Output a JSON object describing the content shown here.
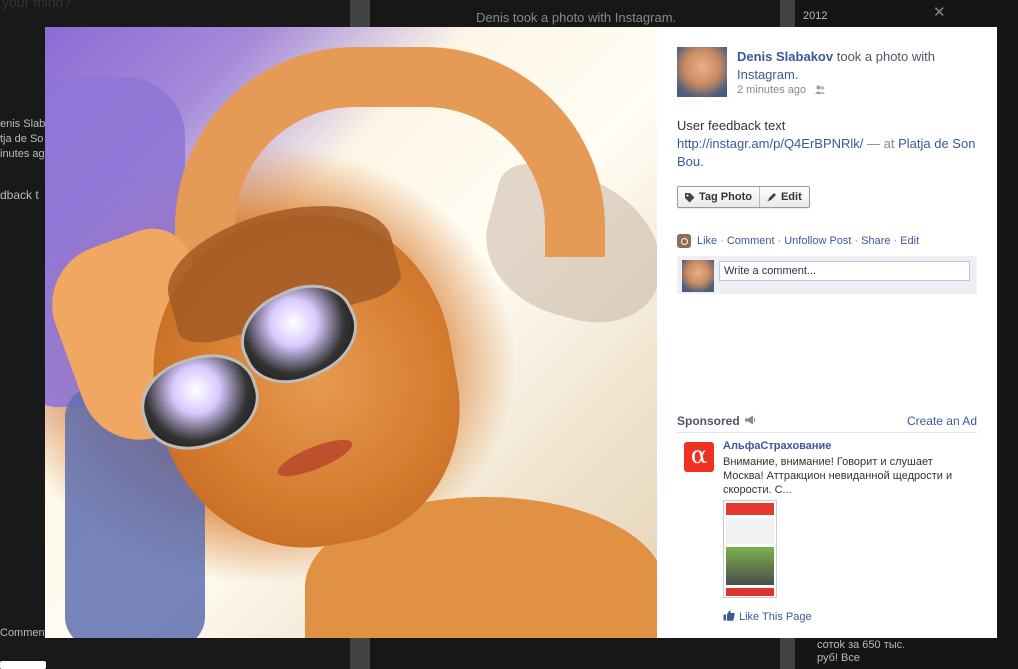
{
  "background": {
    "top_text": "your mind?",
    "story_text": "Denis took a photo with Instagram.",
    "year_label": "2012",
    "left_fragments": [
      "enis Slab",
      "tja de So",
      "inutes ag",
      "dback t",
      "Comment"
    ],
    "right_fragments": [
      "сотоk за 650 тыс.",
      "руб! Все"
    ]
  },
  "post": {
    "author": "Denis Slabakov",
    "action_text": " took a photo with ",
    "app_name": "Instagram.",
    "timestamp": "2 minutes ago",
    "caption_text": "User feedback text",
    "caption_link": "http://instagr.am/p/Q4ErBPNRlk/",
    "at_separator": " — at ",
    "location": "Platja de Son Bou."
  },
  "buttons": {
    "tag_photo": "Tag Photo",
    "edit": "Edit"
  },
  "actions": {
    "like": "Like",
    "comment": "Comment",
    "unfollow": "Unfollow Post",
    "share": "Share",
    "edit": "Edit",
    "separator": "·"
  },
  "comment": {
    "placeholder": "Write a comment..."
  },
  "sponsored": {
    "label": "Sponsored",
    "create_ad": "Create an Ad",
    "ad_title": "АльфаСтрахование",
    "ad_body": "Внимание, внимание! Говорит и слушает Москва! Аттракцион невиданной щедрости и скорости. С...",
    "ad_logo_glyph": "α",
    "like_page": "Like This Page"
  },
  "colors": {
    "link": "#3b5998",
    "ad_brand": "#ef3124"
  },
  "icons": [
    "close-icon",
    "people-icon",
    "tag-icon",
    "pencil-icon",
    "instagram-icon",
    "megaphone-icon",
    "thumbs-up-icon"
  ]
}
